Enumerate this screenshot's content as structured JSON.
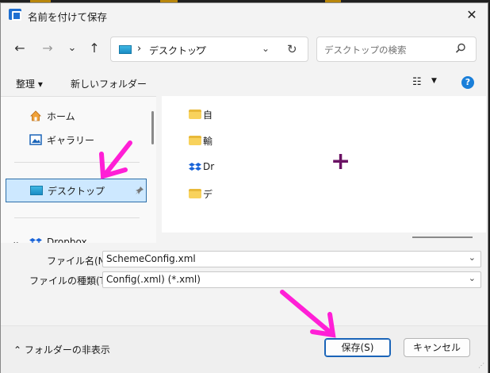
{
  "window": {
    "title": "名前を付けて保存",
    "close_glyph": "✕"
  },
  "nav": {
    "back_glyph": "←",
    "forward_glyph": "→",
    "recent_glyph": "⌄",
    "up_glyph": "↑",
    "address": {
      "sep": "›",
      "location": "デスクトップ",
      "dropdown_glyph": "⌄",
      "refresh_glyph": "↻"
    },
    "search": {
      "placeholder": "デスクトップの検索",
      "icon_glyph": "⚲"
    }
  },
  "toolbar": {
    "organize": "整理 ▾",
    "new_folder": "新しいフォルダー",
    "view_glyph": "☷",
    "view_dd": "▼",
    "help": "?"
  },
  "sidebar": {
    "home": "ホーム",
    "gallery": "ギャラリー",
    "desktop": "デスクトップ",
    "pin_glyph": "📌",
    "dropbox": "Dropbox",
    "expand_glyph": "⌄"
  },
  "files": [
    {
      "name": "自"
    },
    {
      "name": "輸"
    },
    {
      "name": "Dr"
    },
    {
      "name": "デ"
    }
  ],
  "cursor_glyph": "+",
  "form": {
    "filename_label": "ファイル名(N):",
    "filename_value": "SchemeConfig.xml",
    "filetype_label": "ファイルの種類(T):",
    "filetype_value": "Config(.xml) (*.xml)",
    "chevron": "⌄"
  },
  "footer": {
    "hide_folders": "⌃  フォルダーの非表示",
    "save": "保存(S)",
    "cancel": "キャンセル"
  },
  "colors": {
    "annotation": "#ff1fd6",
    "accent": "#1a64b8"
  }
}
